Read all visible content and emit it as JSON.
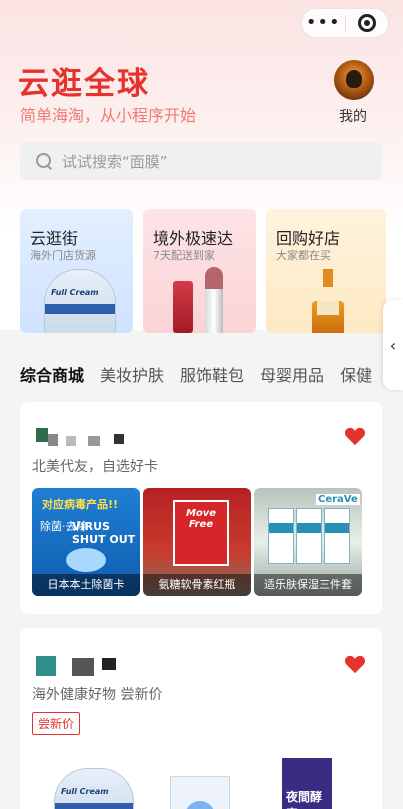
{
  "capsule": {
    "more_glyph": "•••",
    "record_icon": "record-icon"
  },
  "brand": {
    "title": "云逛全球",
    "subtitle": "简单海淘，从小程序开始"
  },
  "profile": {
    "label": "我的"
  },
  "search": {
    "placeholder": "试试搜索“面膜”"
  },
  "feature_cards": [
    {
      "title": "云逛街",
      "subtitle": "海外门店货源",
      "product_text": "Full Cream"
    },
    {
      "title": "境外极速达",
      "subtitle": "7天配送到家"
    },
    {
      "title": "回购好店",
      "subtitle": "大家都在买"
    }
  ],
  "side_tab": {
    "glyph": "‹"
  },
  "tabs": [
    {
      "label": "综合商城",
      "active": true
    },
    {
      "label": "美妆护肤"
    },
    {
      "label": "服饰鞋包"
    },
    {
      "label": "母婴用品"
    },
    {
      "label": "保健"
    }
  ],
  "stores": [
    {
      "description": "北美代友，自选好卡",
      "products": [
        {
          "caption": "日本本土除菌卡",
          "poster_top": "对应病毒产品!!",
          "poster_en": "VIRUS SHUT OUT",
          "poster_cn": "除菌·去除"
        },
        {
          "caption": "氨糖软骨素红瓶",
          "box_text": "Move Free"
        },
        {
          "caption": "适乐肤保湿三件套",
          "brand_text": "CeraVe"
        }
      ]
    },
    {
      "description": "海外健康好物 尝新价",
      "tag": "尝新价",
      "product_texts": [
        "Full Cream",
        "夜間酵素"
      ]
    }
  ],
  "colors": {
    "accent": "#e5322d",
    "heart": "#e5322d"
  }
}
